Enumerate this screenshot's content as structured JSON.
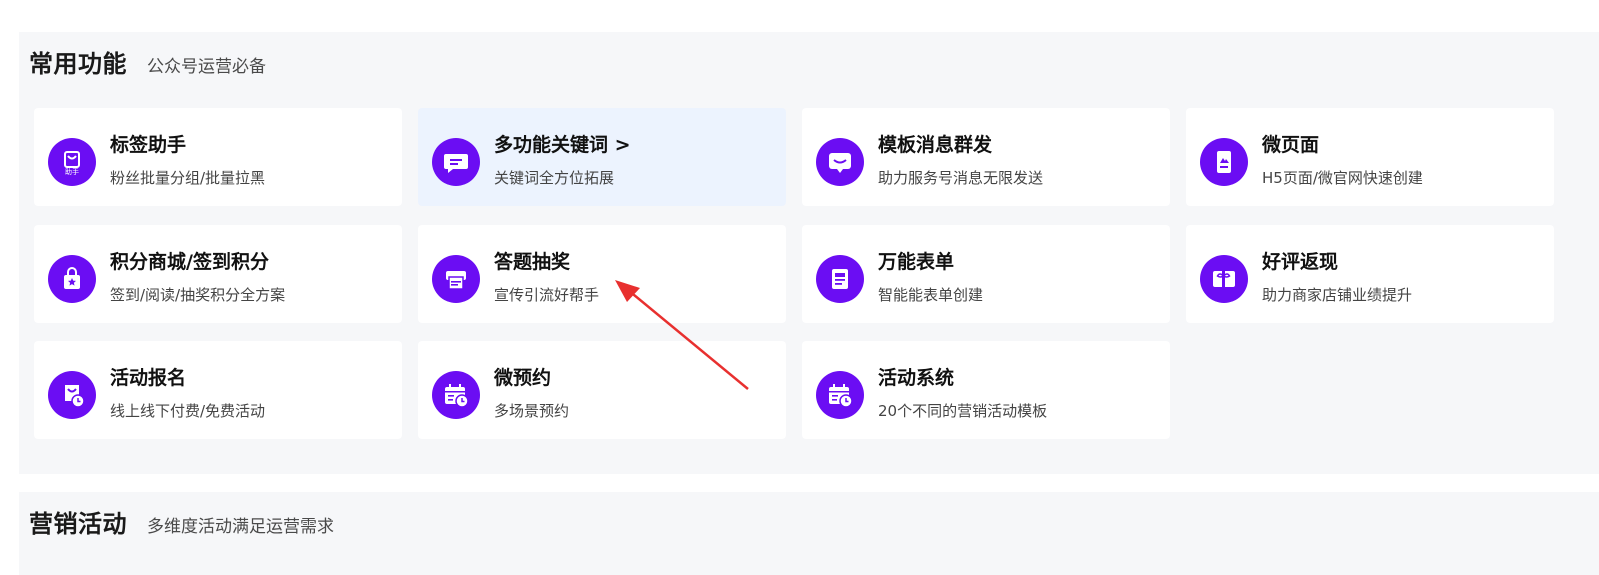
{
  "common": {
    "title": "常用功能",
    "subtitle": "公众号运营必备",
    "cards": [
      {
        "title": "标签助手",
        "desc": "粉丝批量分组/批量拉黑",
        "icon": "tag-helper-icon",
        "icon_text": "助手"
      },
      {
        "title": "多功能关键词 >",
        "desc": "关键词全方位拓展",
        "icon": "chat-keyword-icon"
      },
      {
        "title": "模板消息群发",
        "desc": "助力服务号消息无限发送",
        "icon": "message-smile-icon"
      },
      {
        "title": "微页面",
        "desc": "H5页面/微官网快速创建",
        "icon": "micro-page-icon"
      },
      {
        "title": "积分商城/签到积分",
        "desc": "签到/阅读/抽奖积分全方案",
        "icon": "shopping-bag-star-icon"
      },
      {
        "title": "答题抽奖",
        "desc": "宣传引流好帮手",
        "icon": "printer-icon"
      },
      {
        "title": "万能表单",
        "desc": "智能能表单创建",
        "icon": "form-icon"
      },
      {
        "title": "好评返现",
        "desc": "助力商家店铺业绩提升",
        "icon": "gift-card-icon"
      },
      {
        "title": "活动报名",
        "desc": "线上线下付费/免费活动",
        "icon": "signup-clock-icon"
      },
      {
        "title": "微预约",
        "desc": "多场景预约",
        "icon": "calendar-clock-icon"
      },
      {
        "title": "活动系统",
        "desc": "20个不同的营销活动模板",
        "icon": "calendar-clock-icon"
      }
    ]
  },
  "marketing": {
    "title": "营销活动",
    "subtitle": "多维度活动满足运营需求"
  },
  "colors": {
    "accent": "#6b0df3",
    "panel_bg": "#f6f7f9",
    "active_card_bg": "#ecf3fe",
    "arrow": "#e8302f"
  }
}
